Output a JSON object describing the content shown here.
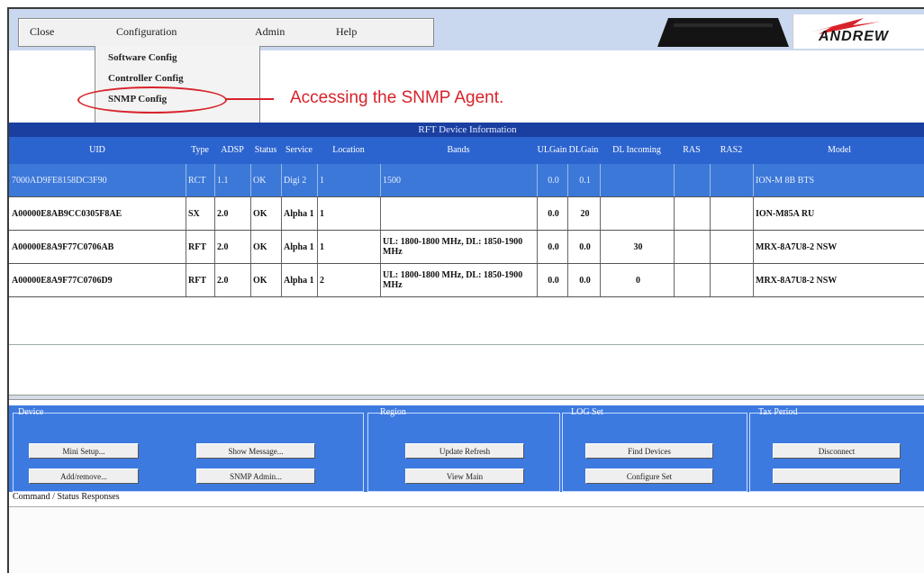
{
  "menubar": {
    "items": [
      "Close",
      "Configuration",
      "Admin",
      "Help"
    ]
  },
  "dropdown": {
    "items": [
      "Software Config",
      "Controller Config",
      "SNMP Config"
    ]
  },
  "callout": {
    "text": "Accessing the SNMP Agent."
  },
  "logo": {
    "text": "ANDREW"
  },
  "table": {
    "title": "RFT Device Information",
    "headers": [
      "UID",
      "Type",
      "ADSP",
      "Status",
      "Service",
      "Location",
      "Bands",
      "ULGain",
      "DLGain",
      "DL Incoming",
      "RAS",
      "RAS2",
      "Model"
    ],
    "rows": [
      {
        "selected": true,
        "cells": [
          "7000AD9FE8158DC3F90",
          "RCT",
          "1.1",
          "OK",
          "Digi 2",
          "1",
          "1500",
          "0.0",
          "0.1",
          "",
          "",
          "",
          "ION-M 8B BTS"
        ]
      },
      {
        "selected": false,
        "cells": [
          "A00000E8AB9CC0305F8AE",
          "SX",
          "2.0",
          "OK",
          "Alpha 1",
          "1",
          "",
          "0.0",
          "20",
          "",
          "",
          "",
          "ION-M85A RU"
        ]
      },
      {
        "selected": false,
        "cells": [
          "A00000E8A9F77C0706AB",
          "RFT",
          "2.0",
          "OK",
          "Alpha 1",
          "1",
          "UL: 1800-1800 MHz, DL: 1850-1900 MHz",
          "0.0",
          "0.0",
          "30",
          "",
          "",
          "MRX-8A7U8-2 NSW"
        ]
      },
      {
        "selected": false,
        "cells": [
          "A00000E8A9F77C0706D9",
          "RFT",
          "2.0",
          "OK",
          "Alpha 1",
          "2",
          "UL: 1800-1800 MHz, DL: 1850-1900 MHz",
          "0.0",
          "0.0",
          "0",
          "",
          "",
          "MRX-8A7U8-2 NSW"
        ]
      }
    ]
  },
  "bottom": {
    "groups": [
      "Device",
      "Region",
      "LOG Set",
      "Tax Period"
    ],
    "buttons": [
      "Mini Setup...",
      "Show Message...",
      "Update Refresh",
      "Find Devices",
      "Disconnect",
      "Add/remove...",
      "SNMP Admin...",
      "View Main",
      "Configure Set"
    ],
    "command_label": "Command / Status Responses"
  },
  "colors": {
    "accent": "#2c64cf",
    "callout": "#d8222a",
    "panel": "#3d7ae0"
  }
}
